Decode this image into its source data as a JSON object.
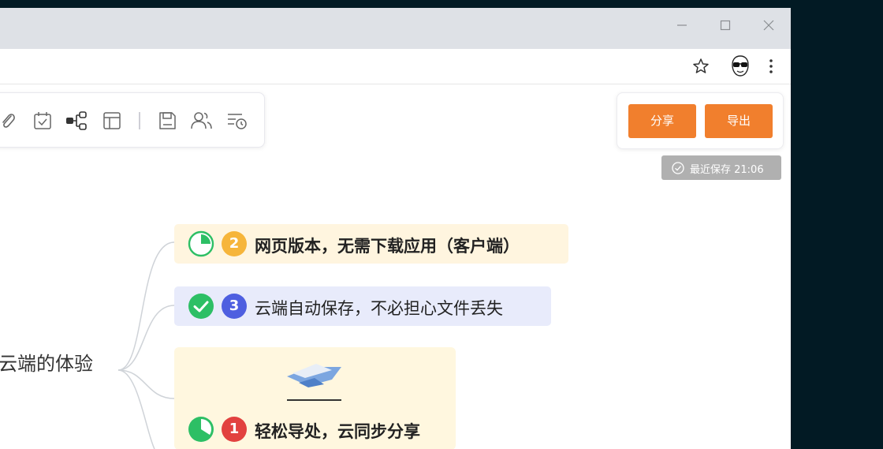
{
  "toolbar": {
    "icons": [
      "attachment-icon",
      "calendar-check-icon",
      "mindmap-structure-icon",
      "layout-icon",
      "save-disk-icon",
      "collaborators-icon",
      "history-list-icon"
    ]
  },
  "actions": {
    "share_label": "分享",
    "export_label": "导出",
    "save_status": "最近保存 21:06"
  },
  "colors": {
    "accent": "#f17f2d",
    "node_yellow_bg": "#fff5df",
    "node_blue_bg": "#e8ebfb",
    "badge_yellow": "#f6b53a",
    "badge_blue": "#4e5fe0",
    "badge_red": "#e2413f",
    "progress_green": "#2dbf65"
  },
  "mindmap": {
    "root": "云端的体验",
    "nodes": [
      {
        "number": "2",
        "text": "网页版本，无需下载应用（客户端）",
        "bold": true,
        "progress": 0.25
      },
      {
        "number": "3",
        "text": "云端自动保存，不必担心文件丢失",
        "bold": false,
        "progress": 1.0
      },
      {
        "number": "1",
        "text": "轻松导处，云同步分享",
        "bold": true,
        "progress": 0.6
      }
    ]
  }
}
